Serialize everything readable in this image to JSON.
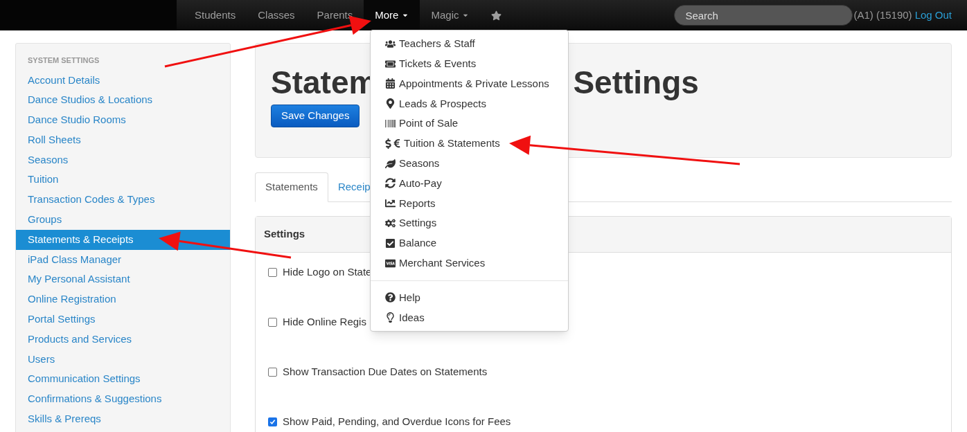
{
  "navbar": {
    "items": [
      {
        "kind": "text",
        "label": "Students",
        "selected": false,
        "dropdown": false
      },
      {
        "kind": "text",
        "label": "Classes",
        "selected": false,
        "dropdown": false
      },
      {
        "kind": "text",
        "label": "Parents",
        "selected": false,
        "dropdown": false
      },
      {
        "kind": "text",
        "label": "More",
        "selected": true,
        "dropdown": true
      },
      {
        "kind": "text",
        "label": "Magic",
        "selected": false,
        "dropdown": true
      },
      {
        "kind": "star",
        "selected": false,
        "dropdown": false
      }
    ],
    "search": {
      "placeholder": "Search"
    },
    "account": "(A1) (15190)",
    "logout": "Log Out"
  },
  "sidebar": {
    "heading": "SYSTEM SETTINGS",
    "items": [
      {
        "label": "Account Details",
        "selected": false
      },
      {
        "label": "Dance Studios & Locations",
        "selected": false
      },
      {
        "label": "Dance Studio Rooms",
        "selected": false
      },
      {
        "label": "Roll Sheets",
        "selected": false
      },
      {
        "label": "Seasons",
        "selected": false
      },
      {
        "label": "Tuition",
        "selected": false
      },
      {
        "label": "Transaction Codes & Types",
        "selected": false
      },
      {
        "label": "Groups",
        "selected": false
      },
      {
        "label": "Statements & Receipts",
        "selected": true
      },
      {
        "label": "iPad Class Manager",
        "selected": false
      },
      {
        "label": "My Personal Assistant",
        "selected": false
      },
      {
        "label": "Online Registration",
        "selected": false
      },
      {
        "label": "Portal Settings",
        "selected": false
      },
      {
        "label": "Products and Services",
        "selected": false
      },
      {
        "label": "Users",
        "selected": false
      },
      {
        "label": "Communication Settings",
        "selected": false
      },
      {
        "label": "Confirmations & Suggestions",
        "selected": false
      },
      {
        "label": "Skills & Prereqs",
        "selected": false
      }
    ]
  },
  "header": {
    "title_parts": [
      "Statem",
      "Settings"
    ],
    "save_button": "Save Changes"
  },
  "tabs": [
    {
      "label": "Statements",
      "selected": true
    },
    {
      "label": "Receip",
      "selected": false
    }
  ],
  "settings_panel": {
    "title": "Settings",
    "options": [
      {
        "label": "Hide Logo on State",
        "checked": false
      },
      {
        "label": "Hide Online Regis",
        "checked": false
      },
      {
        "label": "Show Transaction Due Dates on Statements",
        "checked": false
      },
      {
        "label": "Show Paid, Pending, and Overdue Icons for Fees",
        "checked": true
      }
    ]
  },
  "more_menu": {
    "sections": [
      [
        "Teachers & Staff",
        "Tickets & Events",
        "Appointments & Private Lessons",
        "Leads & Prospects",
        "Point of Sale",
        "Tuition & Statements",
        "Seasons",
        "Auto-Pay",
        "Reports",
        "Settings",
        "Balance",
        "Merchant Services"
      ],
      [
        "Help",
        "Ideas"
      ]
    ]
  }
}
